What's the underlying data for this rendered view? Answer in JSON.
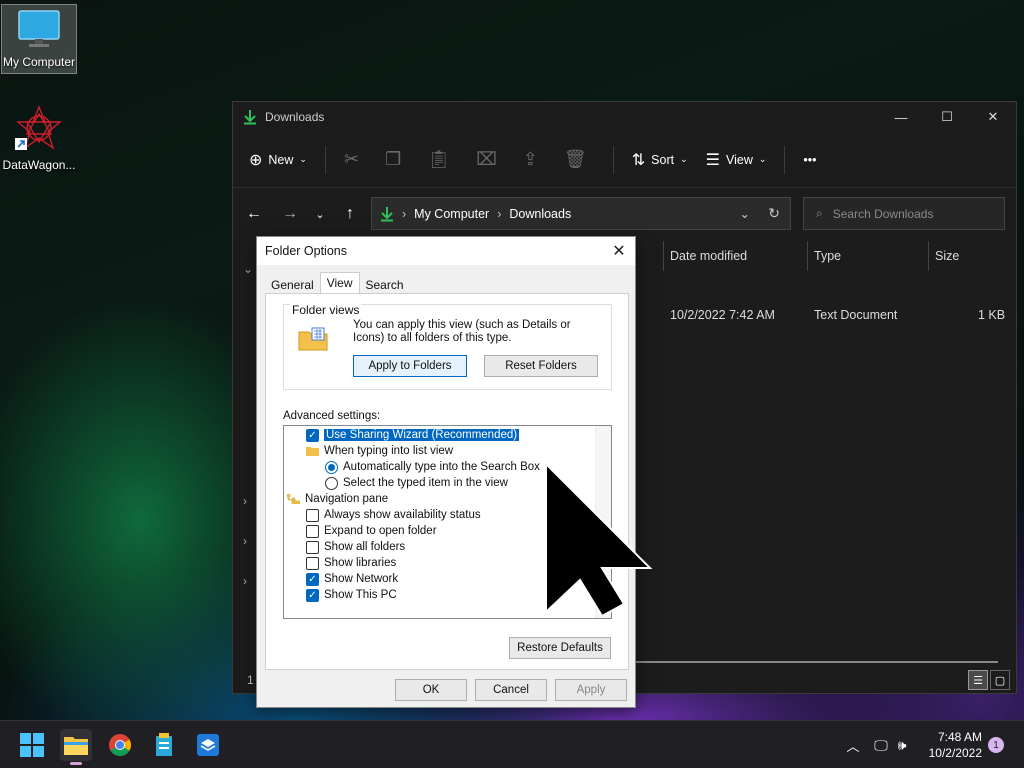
{
  "desktop": {
    "icons": [
      {
        "label": "My Computer"
      },
      {
        "label": "DataWagon..."
      }
    ]
  },
  "explorer": {
    "title": "Downloads",
    "cmdbar": {
      "new": "New",
      "sort": "Sort",
      "view": "View",
      "more": "•••"
    },
    "address": {
      "root": "My Computer",
      "current": "Downloads"
    },
    "search_placeholder": "Search Downloads",
    "columns": [
      "Date modified",
      "Type",
      "Size"
    ],
    "row": {
      "date": "10/2/2022 7:42 AM",
      "type": "Text Document",
      "size": "1 KB"
    },
    "status_count": "1"
  },
  "dialog": {
    "title": "Folder Options",
    "tabs": [
      "General",
      "View",
      "Search"
    ],
    "active_tab": "View",
    "folder_views": {
      "label": "Folder views",
      "text": "You can apply this view (such as Details or Icons) to all folders of this type.",
      "apply_button": "Apply to Folders",
      "reset_button": "Reset Folders"
    },
    "advanced_label": "Advanced settings:",
    "settings": [
      {
        "type": "checkbox",
        "checked": true,
        "selected": true,
        "label": "Use Sharing Wizard (Recommended)"
      },
      {
        "type": "folder",
        "label": "When typing into list view"
      },
      {
        "type": "radio",
        "checked": true,
        "label": "Automatically type into the Search Box"
      },
      {
        "type": "radio",
        "checked": false,
        "label": "Select the typed item in the view"
      },
      {
        "type": "section",
        "label": "Navigation pane"
      },
      {
        "type": "checkbox",
        "checked": false,
        "label": "Always show availability status"
      },
      {
        "type": "checkbox",
        "checked": false,
        "label": "Expand to open folder"
      },
      {
        "type": "checkbox",
        "checked": false,
        "label": "Show all folders"
      },
      {
        "type": "checkbox",
        "checked": false,
        "label": "Show libraries"
      },
      {
        "type": "checkbox",
        "checked": true,
        "label": "Show Network"
      },
      {
        "type": "checkbox",
        "checked": true,
        "label": "Show This PC"
      }
    ],
    "restore_button": "Restore Defaults",
    "ok_button": "OK",
    "cancel_button": "Cancel",
    "apply_button": "Apply"
  },
  "taskbar": {
    "time": "7:48 AM",
    "date": "10/2/2022",
    "notification_count": "1"
  },
  "colors": {
    "accent": "#0067c0",
    "explorer_bg": "#1c1c1c",
    "taskbar_bg": "#1f1f24"
  }
}
